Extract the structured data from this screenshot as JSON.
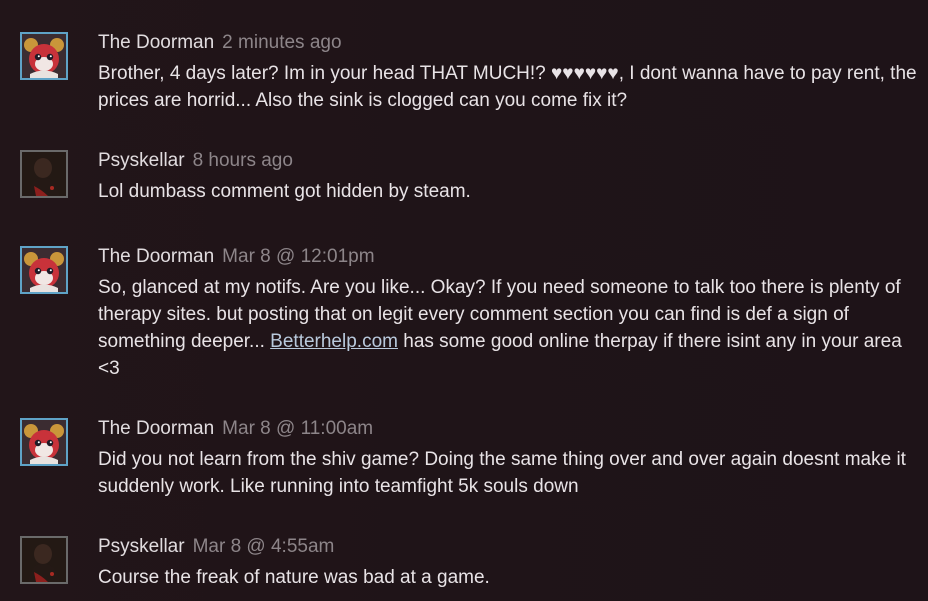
{
  "comments": [
    {
      "author": "The Doorman",
      "timestamp": "2 minutes ago",
      "avatar": "doorman-avatar",
      "text": "Brother, 4 days later? Im in your head THAT MUCH!? ♥♥♥♥♥♥, I dont wanna have to pay rent, the prices are horrid... Also the sink is clogged can you come fix it?"
    },
    {
      "author": "Psyskellar",
      "timestamp": "8 hours ago",
      "avatar": "psyskellar-avatar",
      "text": "Lol dumbass comment got hidden by steam."
    },
    {
      "author": "The Doorman",
      "timestamp": "Mar 8 @ 12:01pm",
      "avatar": "doorman-avatar",
      "text_before": "So, glanced at my notifs. Are you like... Okay? If you need someone to talk too there is plenty of therapy sites. but posting that on legit every comment section you can find is def a sign of something deeper... ",
      "link": "Betterhelp.com",
      "text_after": " has some good online therpay if there isint any in your area <3"
    },
    {
      "author": "The Doorman",
      "timestamp": "Mar 8 @ 11:00am",
      "avatar": "doorman-avatar",
      "text": "Did you not learn from the shiv game? Doing the same thing over and over again doesnt make it suddenly work. Like running into teamfight 5k souls down"
    },
    {
      "author": "Psyskellar",
      "timestamp": "Mar 8 @ 4:55am",
      "avatar": "psyskellar-avatar",
      "text": "Course the freak of nature was bad at a game."
    }
  ],
  "colors": {
    "background": "#1f1418",
    "author": "#e1dcdf",
    "timestamp": "#8d8589",
    "text": "#e8e3e6",
    "link": "#b9c9dc",
    "avatar_border_doorman": "#5fa3c7"
  }
}
